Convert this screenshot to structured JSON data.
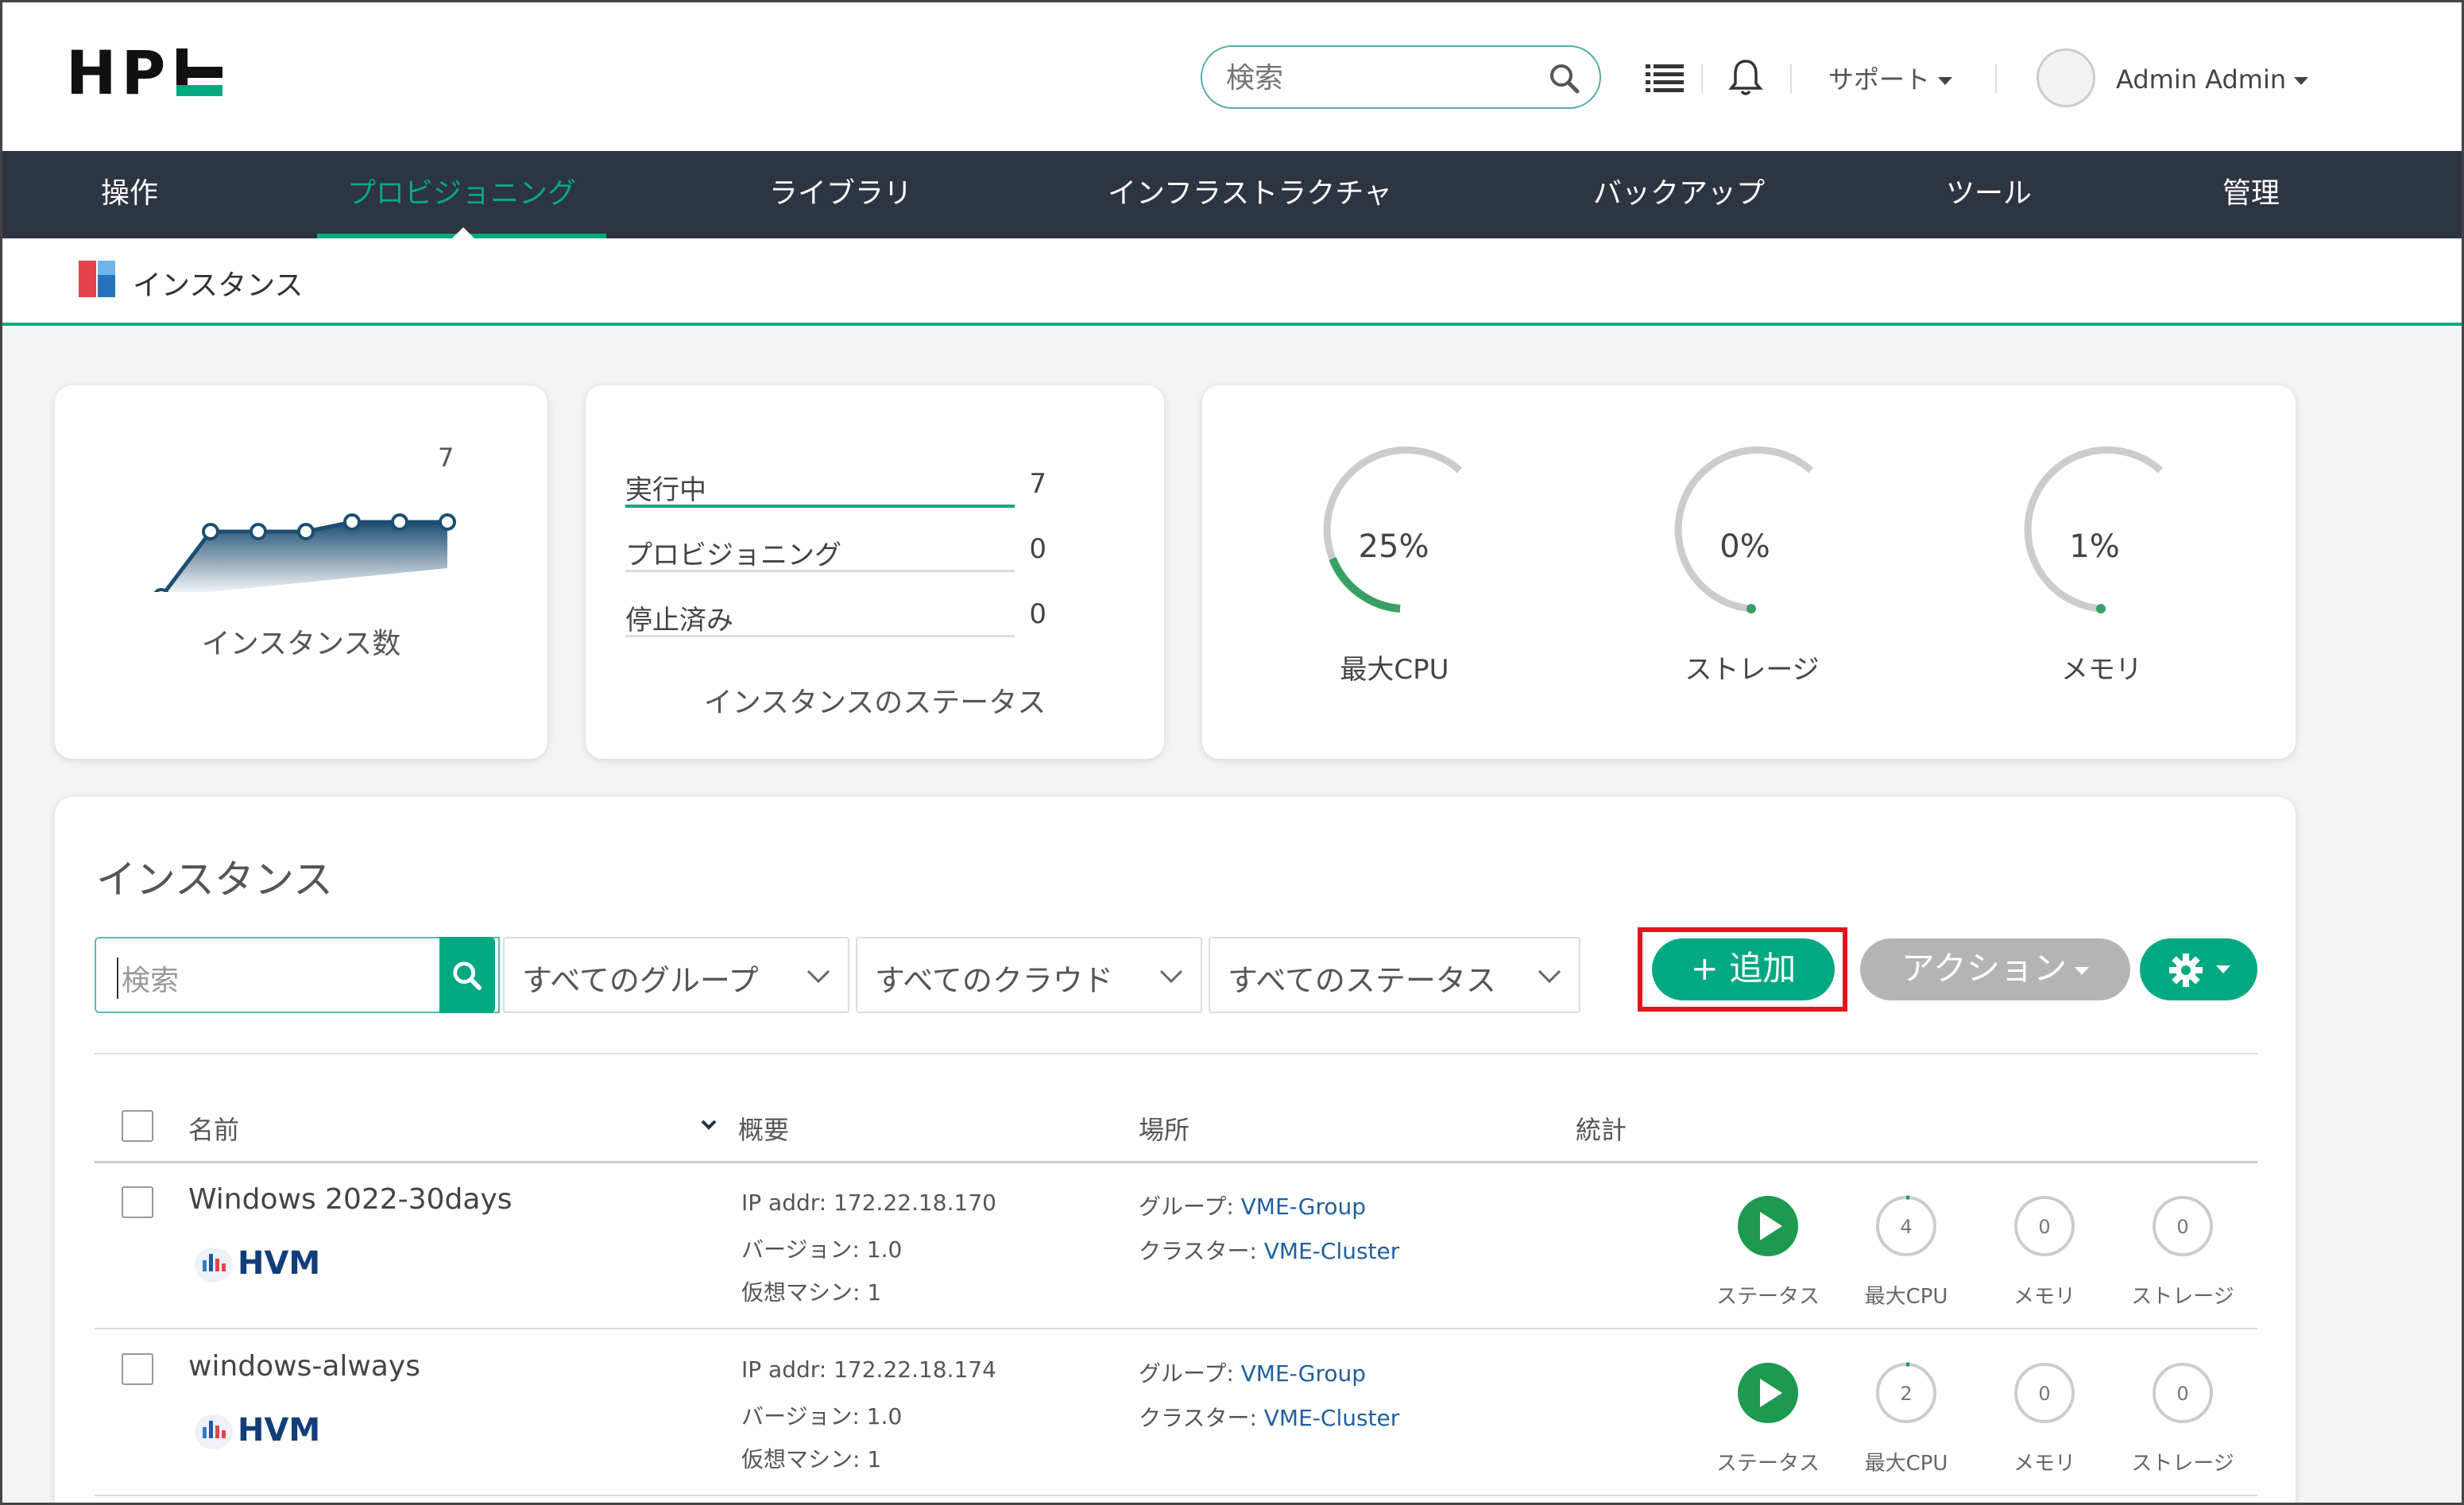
{
  "header": {
    "logo": "HPE",
    "search_placeholder": "検索",
    "support_label": "サポート",
    "user_name": "Admin Admin"
  },
  "nav": {
    "items": [
      "操作",
      "プロビジョニング",
      "ライブラリ",
      "インフラストラクチャ",
      "バックアップ",
      "ツール",
      "管理"
    ],
    "active_index": 1
  },
  "breadcrumb": {
    "title": "インスタンス"
  },
  "summary": {
    "count_card": {
      "caption": "インスタンス数",
      "max_label": "7"
    },
    "status_card": {
      "caption": "インスタンスのステータス",
      "rows": [
        {
          "label": "実行中",
          "value": "7"
        },
        {
          "label": "プロビジョニング",
          "value": "0"
        },
        {
          "label": "停止済み",
          "value": "0"
        }
      ]
    },
    "gauges": [
      {
        "label": "最大CPU",
        "value": "25%",
        "level": 0.25
      },
      {
        "label": "ストレージ",
        "value": "0%",
        "level": 0.0
      },
      {
        "label": "メモリ",
        "value": "1%",
        "level": 0.01
      }
    ]
  },
  "instances": {
    "title": "インスタンス",
    "search_placeholder": "検索",
    "filters": [
      "すべてのグループ",
      "すべてのクラウド",
      "すべてのステータス"
    ],
    "add_label": "+ 追加",
    "actions_label": "アクション",
    "columns": {
      "name": "名前",
      "summary": "概要",
      "location": "場所",
      "stats": "統計"
    },
    "rows": [
      {
        "name": "Windows 2022-30days",
        "platform": "HVM",
        "ip": "IP addr: 172.22.18.170",
        "version": "バージョン: 1.0",
        "vms": "仮想マシン: 1",
        "group_label": "グループ: ",
        "group": "VME-Group",
        "cluster_label": "クラスター: ",
        "cluster": "VME-Cluster",
        "stats": {
          "status": "ステータス",
          "cpu": "最大CPU",
          "cpu_val": "4",
          "memory": "メモリ",
          "memory_val": "0",
          "storage": "ストレージ",
          "storage_val": "0"
        }
      },
      {
        "name": "windows-always",
        "platform": "HVM",
        "ip": "IP addr: 172.22.18.174",
        "version": "バージョン: 1.0",
        "vms": "仮想マシン: 1",
        "group_label": "グループ: ",
        "group": "VME-Group",
        "cluster_label": "クラスター: ",
        "cluster": "VME-Cluster",
        "stats": {
          "status": "ステータス",
          "cpu": "最大CPU",
          "cpu_val": "2",
          "memory": "メモリ",
          "memory_val": "0",
          "storage": "ストレージ",
          "storage_val": "0"
        }
      }
    ]
  },
  "colors": {
    "accent": "#01a982",
    "nav_bg": "#2d3540",
    "highlight": "#e5141b",
    "chart": "#1d4e72"
  }
}
